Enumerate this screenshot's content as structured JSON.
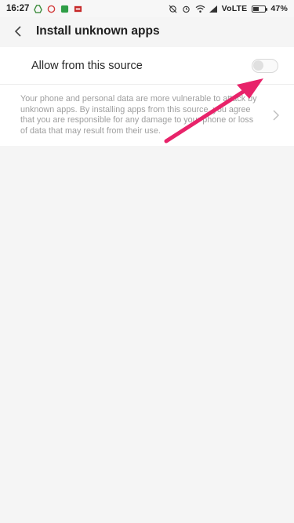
{
  "status_bar": {
    "time": "16:27",
    "network": "VoLTE",
    "battery_percent": "47%",
    "battery_level": 0.47,
    "left_icons": [
      "drive-icon",
      "bug-icon",
      "chat-icon",
      "mail-icon"
    ],
    "right_icons": [
      "no-sync-icon",
      "alarm-icon",
      "wifi-icon",
      "signal-icon",
      "battery-icon"
    ]
  },
  "header": {
    "title": "Install unknown apps",
    "back_icon": "chevron-left-icon"
  },
  "settings": {
    "toggle_label": "Allow from this source",
    "toggle_on": false,
    "description": "Your phone and personal data are more vulnerable to attack by unknown apps. By installing apps from this source, you agree that you are responsible for any damage to your phone or loss of data that may result from their use."
  },
  "colors": {
    "background": "#f5f5f5",
    "card": "#ffffff",
    "annotation_arrow": "#e8236a"
  }
}
